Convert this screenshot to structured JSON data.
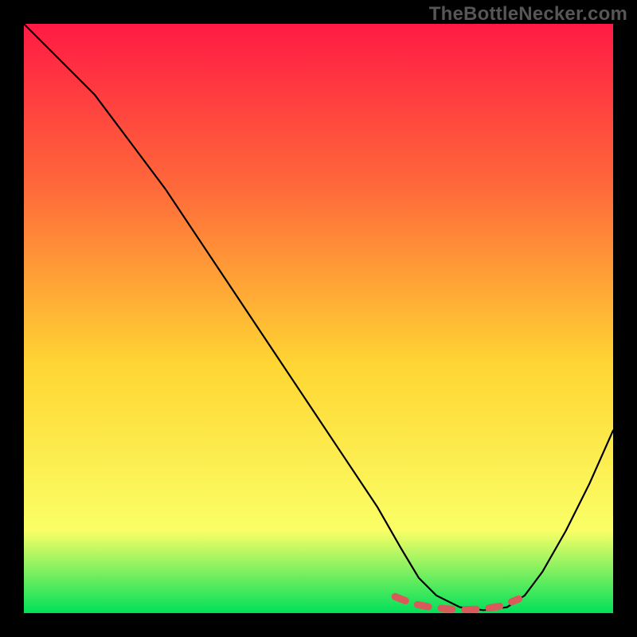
{
  "watermark": "TheBottleNecker.com",
  "chart_data": {
    "type": "line",
    "title": "",
    "xlabel": "",
    "ylabel": "",
    "xlim": [
      0,
      100
    ],
    "ylim": [
      0,
      100
    ],
    "grid": false,
    "background_gradient": {
      "top": "#ff1a44",
      "mid_upper": "#ff6a3a",
      "mid": "#ffd633",
      "mid_lower": "#faff66",
      "bottom": "#00e05a"
    },
    "series": [
      {
        "name": "bottleneck-curve",
        "color": "#000000",
        "x": [
          0,
          6,
          12,
          18,
          24,
          30,
          36,
          42,
          48,
          54,
          60,
          64,
          67,
          70,
          74,
          78,
          82,
          85,
          88,
          92,
          96,
          100
        ],
        "y": [
          100,
          94,
          88,
          80,
          72,
          63,
          54,
          45,
          36,
          27,
          18,
          11,
          6,
          3,
          1,
          0.5,
          1,
          3,
          7,
          14,
          22,
          31
        ]
      },
      {
        "name": "optimal-region-marker",
        "color": "#d85a5a",
        "style": "dashed-thick",
        "x": [
          63,
          66,
          69,
          72,
          75,
          78,
          81,
          84
        ],
        "y": [
          2.8,
          1.6,
          1.0,
          0.7,
          0.6,
          0.7,
          1.2,
          2.4
        ]
      }
    ]
  }
}
